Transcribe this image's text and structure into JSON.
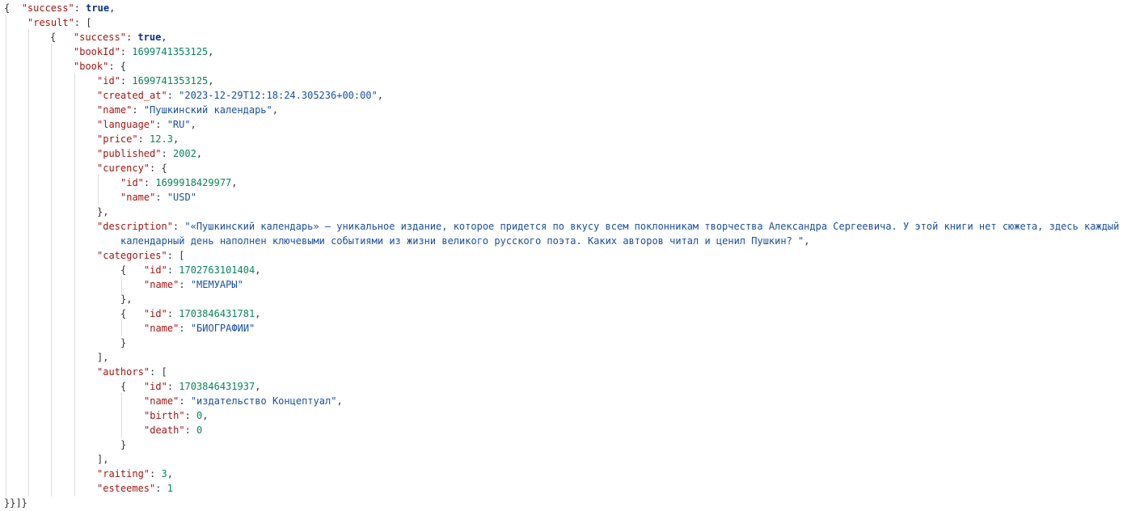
{
  "json_view": {
    "success": "true",
    "result_key": "result",
    "item": {
      "success": "true",
      "bookId": "1699741353125",
      "book": {
        "id": "1699741353125",
        "created_at": "2023-12-29T12:18:24.305236+00:00",
        "name": "Пушкинский календарь",
        "language": "RU",
        "price": "12.3",
        "published": "2002",
        "curency": {
          "id": "1699918429977",
          "name": "USD"
        },
        "description_line1": "«Пушкинский календарь» — уникальное издание, которое придется по вкусу всем поклонникам творчества Александра Сергеевича. У этой книги нет сюжета, здесь каждый",
        "description_line2": "календарный день наполнен ключевыми событиями из жизни великого русского поэта. Каких авторов читал и ценил Пушкин? ",
        "categories": [
          {
            "id": "1702763101404",
            "name": "МЕМУАРЫ"
          },
          {
            "id": "1703846431781",
            "name": "БИОГРАФИИ"
          }
        ],
        "authors": [
          {
            "id": "1703846431937",
            "name": "издательство Концептуал",
            "birth": "0",
            "death": "0"
          }
        ],
        "raiting": "3",
        "esteemes": "1"
      }
    }
  }
}
